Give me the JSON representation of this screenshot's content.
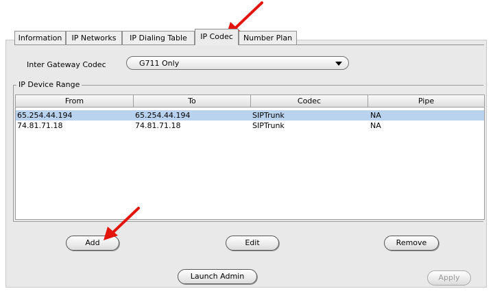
{
  "tabs": [
    {
      "label": "Information",
      "active": false
    },
    {
      "label": "IP Networks",
      "active": false
    },
    {
      "label": "IP Dialing Table",
      "active": false
    },
    {
      "label": "IP Codec",
      "active": true
    },
    {
      "label": "Number Plan",
      "active": false
    }
  ],
  "codec": {
    "label": "Inter Gateway Codec",
    "selected": "G711 Only"
  },
  "device_range": {
    "legend": "IP Device Range",
    "columns": [
      "From",
      "To",
      "Codec",
      "Pipe"
    ],
    "rows": [
      {
        "from": "65.254.44.194",
        "to": "65.254.44.194",
        "codec": "SIPTrunk",
        "pipe": "NA",
        "selected": true
      },
      {
        "from": "74.81.71.18",
        "to": "74.81.71.18",
        "codec": "SIPTrunk",
        "pipe": "NA",
        "selected": false
      }
    ]
  },
  "buttons": {
    "add": "Add",
    "edit": "Edit",
    "remove": "Remove",
    "launch_admin": "Launch Admin",
    "apply": "Apply"
  },
  "colors": {
    "selected_row": "#b9d2ee",
    "annotation_arrow": "#e3140c"
  }
}
